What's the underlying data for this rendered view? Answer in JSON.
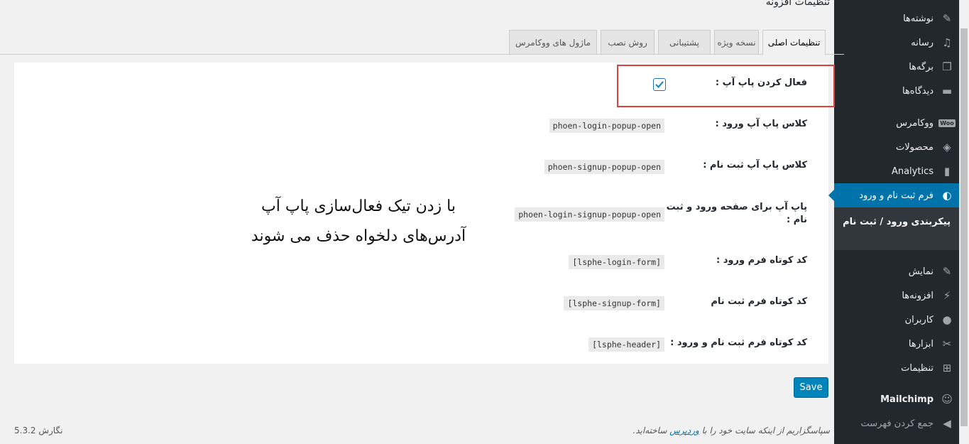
{
  "page_title": "تنظیمات افزونه",
  "tabs": [
    {
      "label": "تنظیمات اصلی",
      "active": true
    },
    {
      "label": "نسخه ویژه",
      "active": false
    },
    {
      "label": "پشتیبانی",
      "active": false
    },
    {
      "label": "روش نصب",
      "active": false
    },
    {
      "label": "ماژول های ووکامرس",
      "active": false
    }
  ],
  "settings": {
    "enable_popup": {
      "label": "فعال کردن پاپ آپ :",
      "checked": true
    },
    "login_class": {
      "label": "کلاس پاپ آپ ورود :",
      "value": "phoen-login-popup-open"
    },
    "signup_class": {
      "label": "کلاس پاپ آپ ثبت نام :",
      "value": "phoen-signup-popup-open"
    },
    "login_signup_class": {
      "label_line1": "پاپ آپ برای صفحه ورود و ثبت",
      "label_line2": "نام :",
      "value": "phoen-login-signup-popup-open"
    },
    "login_shortcode": {
      "label": "کد کوتاه فرم ورود :",
      "value": "[lsphe-login-form]"
    },
    "signup_shortcode": {
      "label": "کد کوتاه فرم ثبت نام",
      "value": "[lsphe-signup-form]"
    },
    "header_shortcode": {
      "label": "کد کوتاه فرم ثبت نام و ورود :",
      "value": "[lsphe-header]"
    }
  },
  "annotation": {
    "line1": "با زدن تیک فعال‌سازی پاپ آپ",
    "line2": "آدرس‌های دلخواه حذف می شوند"
  },
  "save_label": "Save",
  "footer": {
    "thanks_before": "سپاسگزاریم از اینکه سایت خود را با",
    "thanks_link": "وردپرس",
    "thanks_after": "ساخته‌اید.",
    "version": "نگارش 5.3.2"
  },
  "sidebar": {
    "items": [
      {
        "label": "نوشته‌ها",
        "icon": "pin-icon"
      },
      {
        "label": "رسانه",
        "icon": "media-icon"
      },
      {
        "label": "برگه‌ها",
        "icon": "pages-icon"
      },
      {
        "label": "دیدگاه‌ها",
        "icon": "comments-icon"
      },
      {
        "label": "ووکامرس",
        "icon": "woo-icon"
      },
      {
        "label": "محصولات",
        "icon": "products-icon"
      },
      {
        "label": "Analytics",
        "icon": "analytics-icon"
      },
      {
        "label": "فرم ثبت نام و ورود",
        "icon": "form-icon"
      },
      {
        "label": "نمایش",
        "icon": "appearance-icon"
      },
      {
        "label": "افزونه‌ها",
        "icon": "plugins-icon"
      },
      {
        "label": "کاربران",
        "icon": "users-icon"
      },
      {
        "label": "ابزارها",
        "icon": "tools-icon"
      },
      {
        "label": "تنظیمات",
        "icon": "settings-icon"
      },
      {
        "label": "Mailchimp",
        "icon": "mailchimp-icon"
      },
      {
        "label": "جمع کردن فهرست",
        "icon": "collapse-icon"
      }
    ],
    "submenu_label": "پیکربندی ورود / ثبت نام",
    "woo_badge": "Woo",
    "accent_color": "#0073aa"
  }
}
